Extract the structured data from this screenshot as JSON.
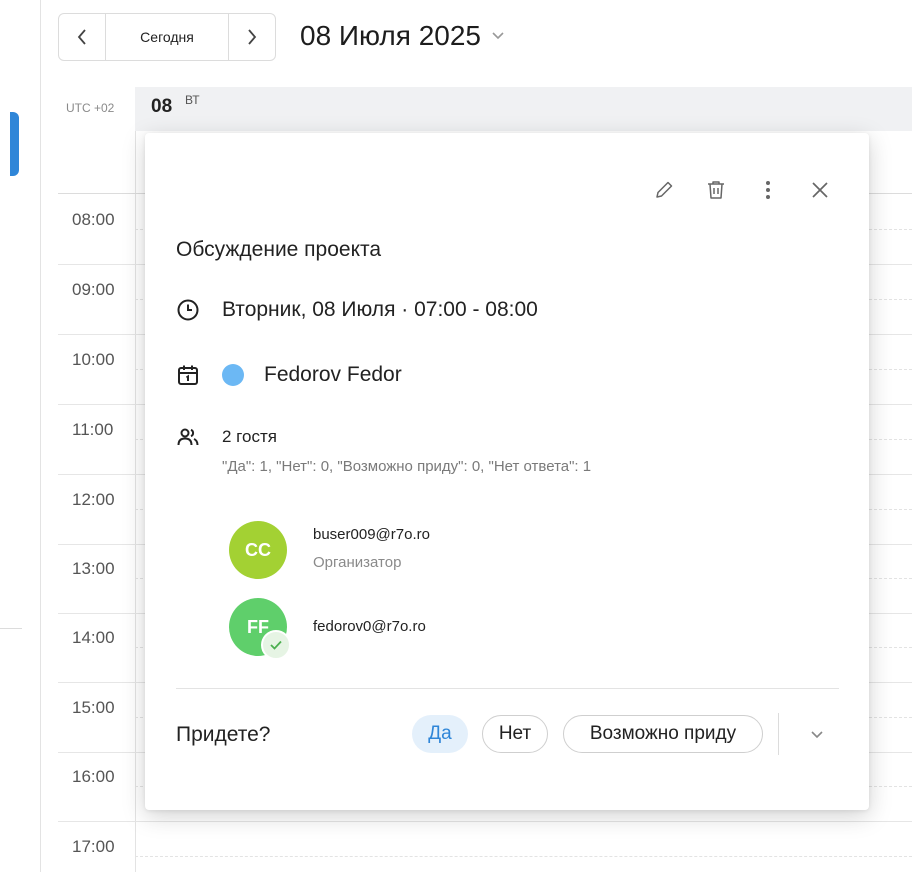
{
  "toolbar": {
    "today_label": "Сегодня",
    "date_title": "08 Июля 2025",
    "prev_icon": "chevron-left-icon",
    "next_icon": "chevron-right-icon"
  },
  "day_header": {
    "timezone": "UTC +02",
    "day_number": "08",
    "weekday": "ВТ"
  },
  "hours": [
    "08:00",
    "09:00",
    "10:00",
    "11:00",
    "12:00",
    "13:00",
    "14:00",
    "15:00",
    "16:00",
    "17:00"
  ],
  "event": {
    "title": "Обсуждение проекта",
    "datetime": "Вторник, 08 Июля · 07:00 - 08:00",
    "calendar_name": "Fedorov Fedor",
    "calendar_color": "#6cb8f4",
    "guests_count": "2 гостя",
    "guests_summary": "\"Да\": 1, \"Нет\": 0, \"Возможно приду\": 0, \"Нет ответа\": 1",
    "guests": [
      {
        "initials": "CC",
        "email": "buser009@r7o.ro",
        "role": "Организатор",
        "color": "#a3d133"
      },
      {
        "initials": "FF",
        "email": "fedorov0@r7o.ro",
        "role": "",
        "color": "#5fcf6b",
        "accepted": true
      }
    ],
    "attend_question": "Придете?",
    "rsvp": {
      "yes": "Да",
      "no": "Нет",
      "maybe": "Возможно приду"
    }
  },
  "colors": {
    "accent": "#2f86d8",
    "rsvp_selected_bg": "#e4f0fb"
  }
}
